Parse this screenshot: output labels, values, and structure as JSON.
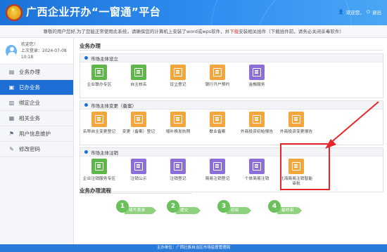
{
  "header": {
    "title": "广西企业开办“一窗通”平台",
    "welcome": "欢迎您，",
    "logout": "退出"
  },
  "notice": {
    "pre": "尊敬的用户您好,为了您能正常使用此系统，请确保您的计算机上安装了word或wps软件，并",
    "link": "下载",
    "post": "安装相关插件（下载插件前，请务必关闭杀毒软件）"
  },
  "user": {
    "greeting": "欢迎您！",
    "last_login": "上次登录：2024-07-08 10:18"
  },
  "sidebar": {
    "items": [
      {
        "label": "业务办理",
        "icon": "document-icon"
      },
      {
        "label": "已办业务",
        "icon": "folder-icon"
      },
      {
        "label": "绑定企业",
        "icon": "link-icon"
      },
      {
        "label": "相关业务",
        "icon": "file-icon"
      },
      {
        "label": "用户信息维护",
        "icon": "user-icon"
      },
      {
        "label": "修改密码",
        "icon": "edit-icon"
      }
    ]
  },
  "main": {
    "title": "业务办理",
    "sections": [
      {
        "title": "市场主体设立",
        "tiles": [
          {
            "label": "企业联办专区",
            "color": "g"
          },
          {
            "label": "自主核名",
            "color": "g"
          },
          {
            "label": "设立登记",
            "color": "o"
          },
          {
            "label": "银行开户预约",
            "color": "o"
          },
          {
            "label": "金融服务",
            "color": "p"
          }
        ]
      },
      {
        "title": "市场主体变更（备案）",
        "tiles": [
          {
            "label": "名称自主变更登记",
            "color": "o"
          },
          {
            "label": "变更（备案）登记",
            "color": "o"
          },
          {
            "label": "增补换发执照",
            "color": "o"
          },
          {
            "label": "歇业备案",
            "color": "o"
          },
          {
            "label": "外商投资初始报告",
            "color": "o"
          },
          {
            "label": "外商投资变更报告",
            "color": "o"
          }
        ]
      },
      {
        "title": "市场主体注销",
        "tiles": [
          {
            "label": "企业注销服务专区",
            "color": "g"
          },
          {
            "label": "注销公示",
            "color": "p"
          },
          {
            "label": "注销登记",
            "color": "p"
          },
          {
            "label": "简易注销登记",
            "color": "p"
          },
          {
            "label": "个体简易注销",
            "color": "p"
          },
          {
            "label": "北海简易注销智能审批",
            "color": "o"
          }
        ]
      }
    ],
    "flow_title": "业务办理流程",
    "flow": [
      {
        "num": "1",
        "label": "填写表单"
      },
      {
        "num": "2",
        "label": "提交"
      },
      {
        "num": "3",
        "label": "初审"
      },
      {
        "num": "4",
        "label": "最终审核"
      }
    ]
  },
  "footer": {
    "text": "主办单位：广西壮族自治区市场监督管理局"
  },
  "colors": {
    "brand": "#1d6fd6",
    "highlight": "#e8262a"
  }
}
